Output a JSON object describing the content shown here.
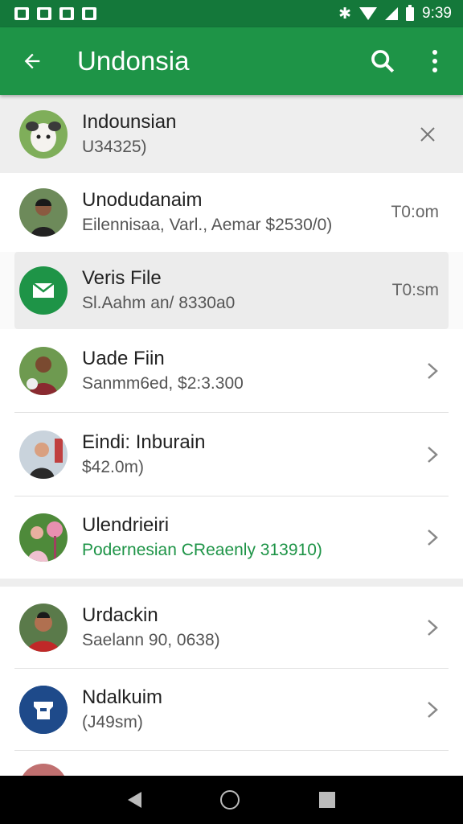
{
  "status_bar": {
    "time": "9:39"
  },
  "app_bar": {
    "title": "Undonsia"
  },
  "header_item": {
    "title": "Indounsian",
    "subtitle": "U34325)"
  },
  "items": [
    {
      "title": "Unodudanaim",
      "subtitle": "Eilennisaa, Varl., Aemar $2530/0)",
      "meta": "T0:om"
    },
    {
      "title": "Veris File",
      "subtitle": "Sl.Aahm an/ 8330a0",
      "meta": "T0:sm"
    },
    {
      "title": "Uade Fiin",
      "subtitle": "Sanmm6ed, $2:3.300"
    },
    {
      "title": "Eindi: Inburain",
      "subtitle": "$42.0m)"
    },
    {
      "title": "Ulendrieiri",
      "subtitle": "Podernesian CReaenly 313910)"
    },
    {
      "title": "Urdackin",
      "subtitle": "Saelann 90, 0638)"
    },
    {
      "title": "Ndalkuim",
      "subtitle": "(J49sm)"
    }
  ],
  "colors": {
    "primary": "#1e9447",
    "primary_dark": "#14783a",
    "accent_green": "#1e9447"
  }
}
